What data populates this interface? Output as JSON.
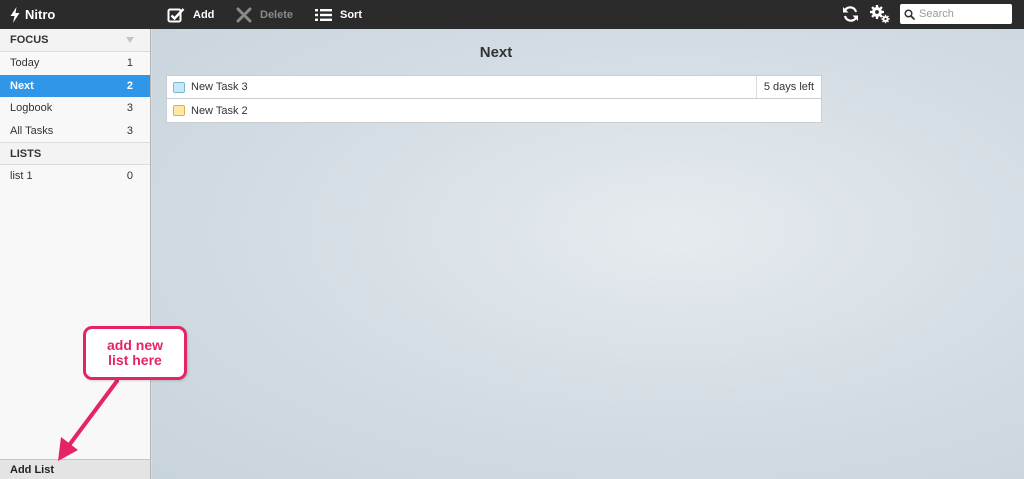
{
  "app": {
    "name": "Nitro"
  },
  "toolbar": {
    "add_label": "Add",
    "delete_label": "Delete",
    "sort_label": "Sort"
  },
  "search": {
    "placeholder": "Search",
    "value": ""
  },
  "header_icons": [
    "refresh-icon",
    "settings-icon",
    "search-icon"
  ],
  "sidebar": {
    "focus_header": "FOCUS",
    "focus_items": [
      {
        "label": "Today",
        "count": "1"
      },
      {
        "label": "Next",
        "count": "2",
        "active": true
      },
      {
        "label": "Logbook",
        "count": "3"
      },
      {
        "label": "All Tasks",
        "count": "3"
      }
    ],
    "lists_header": "LISTS",
    "list_items": [
      {
        "label": "list 1",
        "count": "0"
      }
    ],
    "add_list_label": "Add List"
  },
  "main": {
    "title": "Next",
    "tasks": [
      {
        "title": "New Task 3",
        "due": "5 days left",
        "color": "blue"
      },
      {
        "title": "New Task 2",
        "due": "",
        "color": "yellow"
      }
    ]
  },
  "annotation": {
    "line1": "add new",
    "line2": "list here",
    "color": "#e52465"
  },
  "colors": {
    "topbar": "#2b2b2b",
    "active_item": "#2f96e8",
    "annotation": "#e52465"
  }
}
